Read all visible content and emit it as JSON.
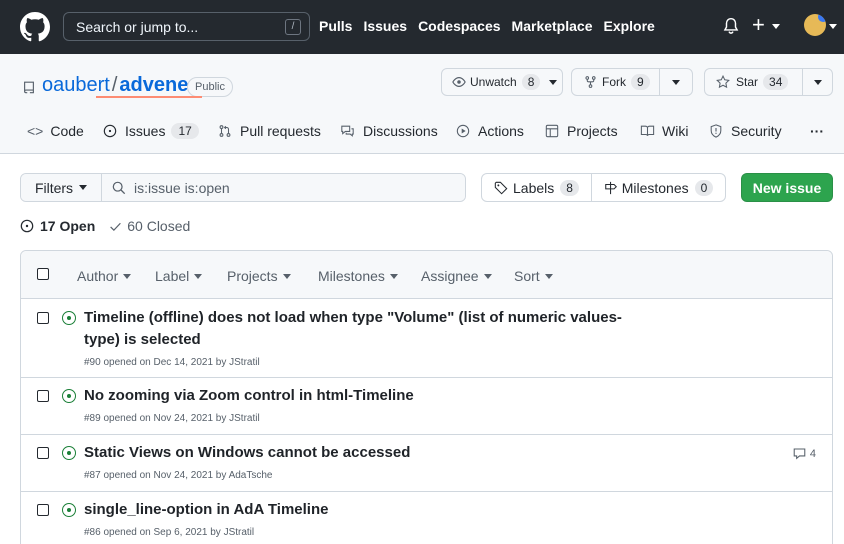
{
  "header": {
    "search_placeholder": "Search or jump to...",
    "slash_key": "/",
    "nav": [
      "Pulls",
      "Issues",
      "Codespaces",
      "Marketplace",
      "Explore"
    ]
  },
  "repo": {
    "owner": "oaubert",
    "separator": "/",
    "name": "advene",
    "visibility": "Public",
    "unwatch_label": "Unwatch",
    "watch_count": "8",
    "fork_label": "Fork",
    "fork_count": "9",
    "star_label": "Star",
    "star_count": "34"
  },
  "tabs": {
    "code": "Code",
    "issues": "Issues",
    "issues_count": "17",
    "pull_requests": "Pull requests",
    "discussions": "Discussions",
    "actions": "Actions",
    "projects": "Projects",
    "wiki": "Wiki",
    "security": "Security",
    "more": "···"
  },
  "toolbar": {
    "filters_label": "Filters",
    "search_value": "is:issue is:open",
    "labels_label": "Labels",
    "labels_count": "8",
    "milestones_label": "Milestones",
    "milestones_count": "0",
    "new_issue_label": "New issue"
  },
  "state": {
    "open_label": "17 Open",
    "closed_label": "60 Closed"
  },
  "list_header": {
    "author": "Author",
    "label": "Label",
    "projects": "Projects",
    "milestones": "Milestones",
    "assignee": "Assignee",
    "sort": "Sort"
  },
  "issues": [
    {
      "title_line1": "Timeline (offline) does not load when type \"Volume\" (list of numeric values-",
      "title_line2": "type) is selected",
      "meta": "#90 opened on Dec 14, 2021 by JStratil"
    },
    {
      "title": "No zooming via Zoom control in html-Timeline",
      "meta": "#89 opened on Nov 24, 2021 by JStratil"
    },
    {
      "title": "Static Views on Windows cannot be accessed",
      "meta": "#87 opened on Nov 24, 2021 by AdaTsche",
      "comments": "4"
    },
    {
      "title": "single_line-option in AdA Timeline",
      "meta": "#86 opened on Sep 6, 2021 by JStratil"
    }
  ],
  "colors": {
    "header_bg": "#24292f",
    "link_blue": "#0969da",
    "primary_green": "#2da44e",
    "open_green": "#1a7f37",
    "tab_underline": "#fd8c73"
  }
}
